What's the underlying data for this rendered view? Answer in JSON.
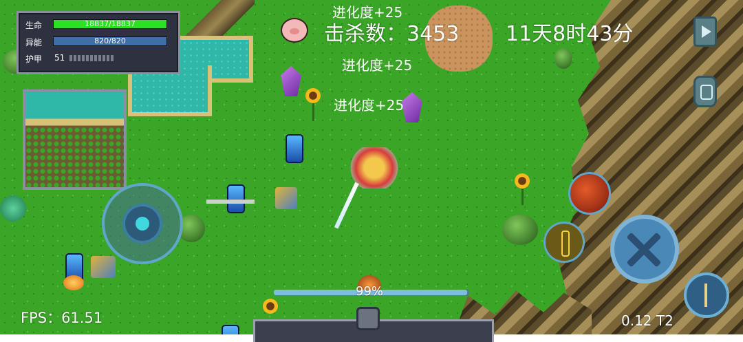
{
  "stats": {
    "hp_label": "生命",
    "hp_value": "18837/18837",
    "hp_fraction": 1.0,
    "energy_label": "异能",
    "energy_value": "820/820",
    "energy_fraction": 1.0,
    "armor_label": "护甲",
    "armor_value": "51"
  },
  "hud": {
    "kills_label": "击杀数：",
    "kills_value": "3453",
    "game_time": "11天8时43分",
    "fps": "FPS：61.51",
    "corner_info": "0.12 T2",
    "progress_label": "99%",
    "progress_fraction": 0.99
  },
  "floating_texts": [
    "进化度+25",
    "进化度+25",
    "进化度+25"
  ],
  "icons": {
    "pig": "pig-face-icon",
    "play": "play-icon",
    "backpack": "backpack-icon",
    "fireball": "fireball-skill-icon",
    "figure": "golden-figure-skill-icon",
    "attack": "crossed-swords-icon",
    "sword": "sword-skill-icon"
  },
  "colors": {
    "hp": "#2ee024",
    "energy": "#3f6fa8",
    "armor": "#7a7f8a",
    "button_blue": "#4a88b8"
  }
}
